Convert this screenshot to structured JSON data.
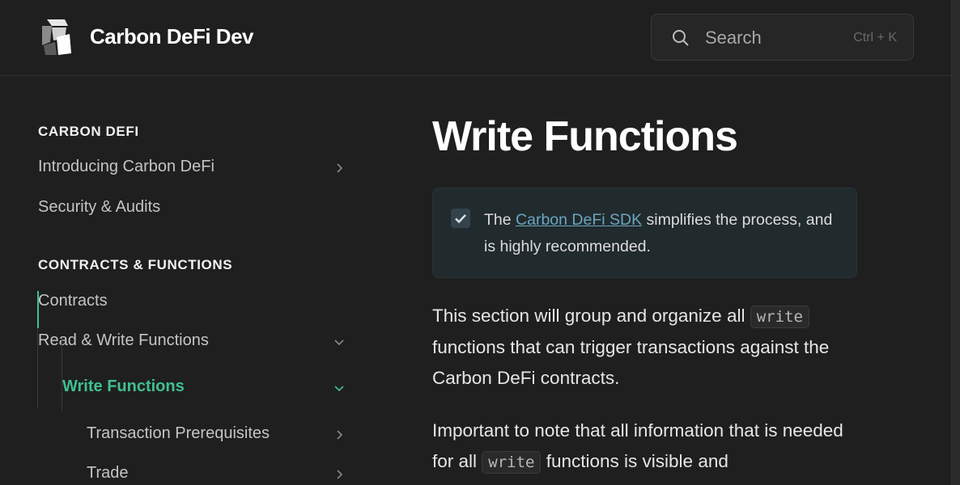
{
  "header": {
    "brand": "Carbon DeFi Dev",
    "search_placeholder": "Search",
    "search_shortcut": "Ctrl + K"
  },
  "sidebar": {
    "sections": [
      {
        "heading": "CARBON DEFI",
        "items": [
          {
            "label": "Introducing Carbon DeFi",
            "chevron": "right"
          },
          {
            "label": "Security & Audits"
          }
        ]
      },
      {
        "heading": "CONTRACTS & FUNCTIONS",
        "items": [
          {
            "label": "Contracts"
          },
          {
            "label": "Read & Write Functions",
            "chevron": "down"
          },
          {
            "label": "Write Functions",
            "chevron": "down",
            "active": true
          },
          {
            "label": "Transaction Prerequisites",
            "chevron": "right"
          },
          {
            "label": "Trade",
            "chevron": "right"
          }
        ]
      }
    ]
  },
  "main": {
    "title": "Write Functions",
    "callout": {
      "prefix": "The ",
      "link": "Carbon DeFi SDK",
      "suffix": " simplifies the process, and is highly recommended."
    },
    "para1": {
      "a": "This section will group and organize all ",
      "code": "write",
      "b": " functions that can trigger transactions against the Carbon DeFi contracts."
    },
    "para2": {
      "a": "Important to note that all information that is needed for all ",
      "code": "write",
      "b": " functions is visible and"
    }
  },
  "colors": {
    "accent": "#40c08f",
    "link": "#6aa6c0",
    "background": "#1f1f1f"
  },
  "icons": [
    "logo-icon",
    "search-icon",
    "chevron-right-icon",
    "chevron-down-icon",
    "check-icon"
  ]
}
